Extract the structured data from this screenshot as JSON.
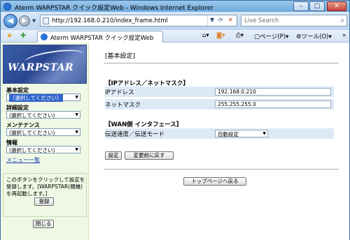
{
  "window": {
    "title": "Aterm WARPSTAR クイック設定Web - Windows Internet Explorer",
    "minimize": "–",
    "maximize": "□",
    "close": "✕"
  },
  "address": {
    "url": "http://192.168.0.210/index_frame.html",
    "search_placeholder": "Live Search"
  },
  "tab": {
    "label": "Aterm WARPSTAR クイック設定Web"
  },
  "commands": {
    "page": "ページ(P)",
    "tools": "ツール(O)"
  },
  "sidebar": {
    "logo_text": "WARPSTAR",
    "menus": [
      {
        "heading": "基本設定",
        "selected": "（選択してください）",
        "highlighted": true
      },
      {
        "heading": "詳細設定",
        "selected": "(選択してください)",
        "highlighted": false
      },
      {
        "heading": "メンテナンス",
        "selected": "(選択してください)",
        "highlighted": false
      },
      {
        "heading": "情報",
        "selected": "(選択してください)",
        "highlighted": false
      }
    ],
    "menu_link": "メニュー一覧",
    "note": "このボタンをクリックして設定を登録します。[WARPSTAR(親機)を再起動します。]",
    "register_button": "登録",
    "close_button": "閉じる"
  },
  "main": {
    "page_title": "[基本設定]",
    "ip_section": "【IPアドレス／ネットマスク】",
    "ip_label": "IPアドレス",
    "ip_value": "192.168.0.210",
    "mask_label": "ネットマスク",
    "mask_value": "255.255.255.0",
    "wan_section": "【WAN側 インタフェース】",
    "speed_label": "伝送速度／伝送モード",
    "speed_value": "自動設定",
    "set_button": "設定",
    "revert_button": "変更前に戻す",
    "top_button": "トップページへ戻る"
  }
}
